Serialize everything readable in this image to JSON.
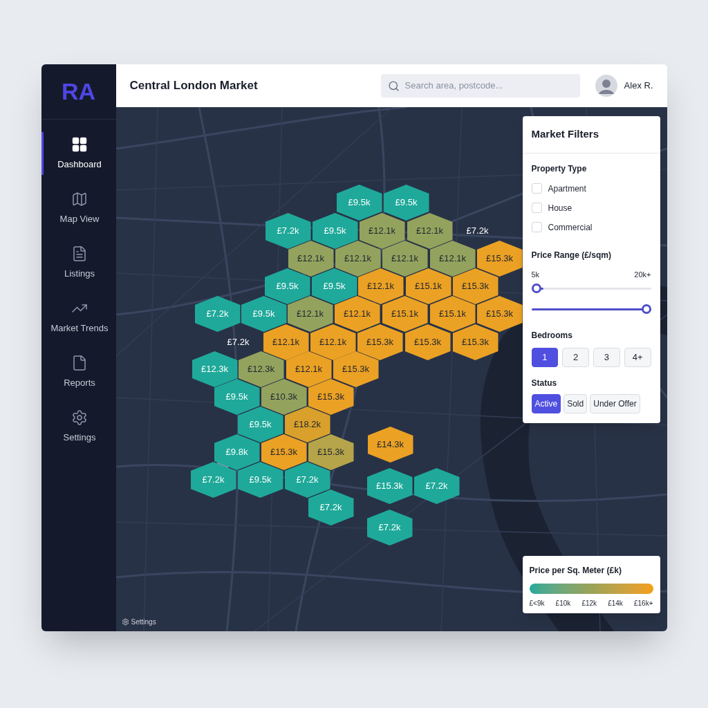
{
  "logo": "RA",
  "sidebar": {
    "items": [
      {
        "label": "Dashboard",
        "selected": true
      },
      {
        "label": "Map View",
        "selected": false
      },
      {
        "label": "Listings",
        "selected": false
      },
      {
        "label": "Market Trends",
        "selected": false
      },
      {
        "label": "Reports",
        "selected": false
      },
      {
        "label": "Settings",
        "selected": false
      }
    ]
  },
  "header": {
    "title": "Central London Market",
    "search": {
      "placeholder": "Search area, postcode..."
    },
    "user": "Alex R."
  },
  "map": {
    "hexes": [
      {
        "value": "£9.5k",
        "kind": "hex",
        "color": "#1fa99a"
      },
      {
        "value": "£9.5k",
        "kind": "hex",
        "color": "#1fa99a"
      },
      {
        "value": "£7.2k",
        "kind": "hex",
        "color": "#1fa99a"
      },
      {
        "value": "£9.5k",
        "kind": "hex",
        "color": "#1fa99a"
      },
      {
        "value": "£12.1k",
        "kind": "hex",
        "color": "#93a35e"
      },
      {
        "value": "£12.1k",
        "kind": "hex",
        "color": "#93a35e"
      },
      {
        "value": "£7.2k",
        "kind": "label",
        "color": "#ffffff"
      },
      {
        "value": "£12.1k",
        "kind": "hex",
        "color": "#93a35e"
      },
      {
        "value": "£12.1k",
        "kind": "hex",
        "color": "#93a35e"
      },
      {
        "value": "£12.1k",
        "kind": "hex",
        "color": "#93a35e"
      },
      {
        "value": "£12.1k",
        "kind": "hex",
        "color": "#93a35e"
      },
      {
        "value": "£15.3k",
        "kind": "hex",
        "color": "#eba124"
      },
      {
        "value": "£9.5k",
        "kind": "hex",
        "color": "#1fa99a"
      },
      {
        "value": "£9.5k",
        "kind": "hex",
        "color": "#1fa99a"
      },
      {
        "value": "£12.1k",
        "kind": "hex",
        "color": "#eba124"
      },
      {
        "value": "£15.1k",
        "kind": "hex",
        "color": "#eba124"
      },
      {
        "value": "£15.3k",
        "kind": "hex",
        "color": "#eba124"
      },
      {
        "value": "£7.2k",
        "kind": "hex",
        "color": "#1fa99a"
      },
      {
        "value": "£9.5k",
        "kind": "hex",
        "color": "#1fa99a"
      },
      {
        "value": "£12.1k",
        "kind": "hex",
        "color": "#93a35e"
      },
      {
        "value": "£12.1k",
        "kind": "hex",
        "color": "#eba124"
      },
      {
        "value": "£15.1k",
        "kind": "hex",
        "color": "#eba124"
      },
      {
        "value": "£15.1k",
        "kind": "hex",
        "color": "#eba124"
      },
      {
        "value": "£15.3k",
        "kind": "hex",
        "color": "#eba124"
      },
      {
        "value": "£7.2k",
        "kind": "label",
        "color": "#ffffff"
      },
      {
        "value": "£12.1k",
        "kind": "hex",
        "color": "#eba124"
      },
      {
        "value": "£12.1k",
        "kind": "hex",
        "color": "#eba124"
      },
      {
        "value": "£15.3k",
        "kind": "hex",
        "color": "#eba124"
      },
      {
        "value": "£15.3k",
        "kind": "hex",
        "color": "#eba124"
      },
      {
        "value": "£15.3k",
        "kind": "hex",
        "color": "#eba124"
      },
      {
        "value": "£12.3k",
        "kind": "hex",
        "color": "#1fa99a"
      },
      {
        "value": "£12.3k",
        "kind": "hex",
        "color": "#93a35e"
      },
      {
        "value": "£12.1k",
        "kind": "hex",
        "color": "#eba124"
      },
      {
        "value": "£15.3k",
        "kind": "hex",
        "color": "#eba124"
      },
      {
        "value": "£9.5k",
        "kind": "hex",
        "color": "#1fa99a"
      },
      {
        "value": "£10.3k",
        "kind": "hex",
        "color": "#93a35e"
      },
      {
        "value": "£15.3k",
        "kind": "hex",
        "color": "#eba124"
      },
      {
        "value": "£9.5k",
        "kind": "hex",
        "color": "#1fa99a"
      },
      {
        "value": "£18.2k",
        "kind": "hex",
        "color": "#d9a12c"
      },
      {
        "value": "£9.8k",
        "kind": "hex",
        "color": "#1fa99a"
      },
      {
        "value": "£15.3k",
        "kind": "hex",
        "color": "#eba124"
      },
      {
        "value": "£15.3k",
        "kind": "hex",
        "color": "#b5a44a"
      },
      {
        "value": "£14.3k",
        "kind": "hex",
        "color": "#eba124"
      },
      {
        "value": "£7.2k",
        "kind": "hex",
        "color": "#1fa99a"
      },
      {
        "value": "£9.5k",
        "kind": "hex",
        "color": "#1fa99a"
      },
      {
        "value": "£7.2k",
        "kind": "hex",
        "color": "#1fa99a"
      },
      {
        "value": "£15.3k",
        "kind": "hex",
        "color": "#1fa99a"
      },
      {
        "value": "£7.2k",
        "kind": "hex",
        "color": "#1fa99a"
      },
      {
        "value": "£7.2k",
        "kind": "hex",
        "color": "#1fa99a"
      },
      {
        "value": "£7.2k",
        "kind": "hex",
        "color": "#1fa99a"
      }
    ],
    "footer_link": "Settings"
  },
  "filters": {
    "title": "Market Filters",
    "property_type": {
      "label": "Property Type",
      "options": [
        {
          "label": "Apartment",
          "checked": false
        },
        {
          "label": "House",
          "checked": false
        },
        {
          "label": "Commercial",
          "checked": false
        }
      ]
    },
    "price_range": {
      "label": "Price Range (£/sqm)",
      "min_label": "5k",
      "max_label": "20k+",
      "sliders": [
        {
          "level": 0.1
        },
        {
          "level": 1
        }
      ]
    },
    "bedrooms": {
      "label": "Bedrooms",
      "options": [
        {
          "label": "1",
          "selected": true
        },
        {
          "label": "2",
          "selected": false
        },
        {
          "label": "3",
          "selected": false
        },
        {
          "label": "4+",
          "selected": false
        }
      ]
    },
    "status": {
      "label": "Status",
      "options": [
        {
          "label": "Active",
          "selected": true
        },
        {
          "label": "Sold",
          "selected": false
        },
        {
          "label": "Under Offer",
          "selected": false
        }
      ]
    }
  },
  "legend": {
    "title": "Price per Sq. Meter (£k)",
    "ticks": [
      "£<9k",
      "£10k",
      "£12k",
      "£14k",
      "£16k+"
    ]
  }
}
